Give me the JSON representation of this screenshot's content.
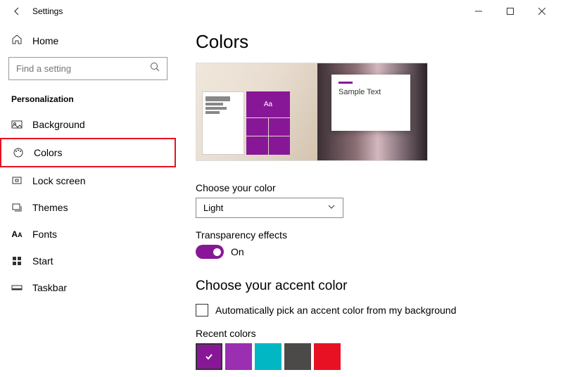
{
  "titlebar": {
    "title": "Settings"
  },
  "sidebar": {
    "home": "Home",
    "search_placeholder": "Find a setting",
    "category": "Personalization",
    "items": [
      {
        "label": "Background"
      },
      {
        "label": "Colors"
      },
      {
        "label": "Lock screen"
      },
      {
        "label": "Themes"
      },
      {
        "label": "Fonts"
      },
      {
        "label": "Start"
      },
      {
        "label": "Taskbar"
      }
    ]
  },
  "content": {
    "page_title": "Colors",
    "preview": {
      "sample_text": "Sample Text",
      "tile_aa": "Aa"
    },
    "choose_color_label": "Choose your color",
    "choose_color_value": "Light",
    "transparency_label": "Transparency effects",
    "transparency_state": "On",
    "accent_title": "Choose your accent color",
    "auto_pick_label": "Automatically pick an accent color from my background",
    "recent_colors_label": "Recent colors",
    "recent_colors": [
      "#881798",
      "#9a2fb2",
      "#00b7c3",
      "#4c4a48",
      "#e81123"
    ]
  }
}
